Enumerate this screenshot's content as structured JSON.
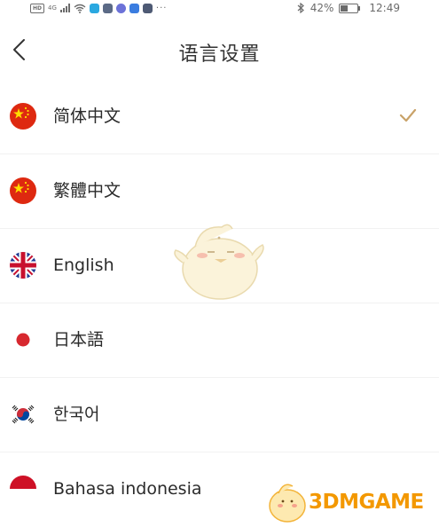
{
  "status_bar": {
    "network": "4G",
    "battery": "42%",
    "battery_level": 0.42,
    "time": "12:49",
    "more": "···"
  },
  "header": {
    "title": "语言设置",
    "back_icon": "chevron-left-icon"
  },
  "languages": [
    {
      "label": "简体中文",
      "flag": "china-flag-icon",
      "selected": true
    },
    {
      "label": "繁體中文",
      "flag": "china-flag-icon",
      "selected": false
    },
    {
      "label": "English",
      "flag": "uk-flag-icon",
      "selected": false
    },
    {
      "label": "日本語",
      "flag": "japan-flag-icon",
      "selected": false
    },
    {
      "label": "한국어",
      "flag": "korea-flag-icon",
      "selected": false
    },
    {
      "label": "Bahasa indonesia",
      "flag": "indonesia-flag-icon",
      "selected": false
    }
  ],
  "colors": {
    "check": "#c9a268",
    "china_red": "#de2910",
    "china_yellow": "#ffde00",
    "watermark": "#f39800"
  },
  "watermark": {
    "text": "3DMGAME"
  }
}
